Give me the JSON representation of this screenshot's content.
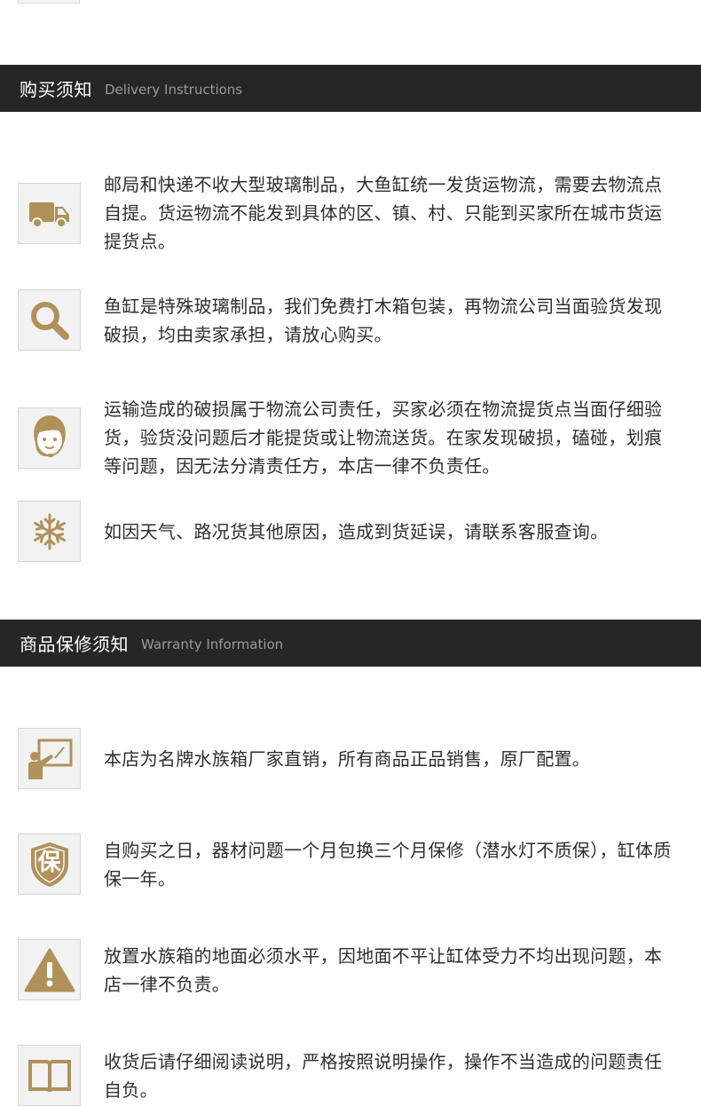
{
  "colors": {
    "header_bg": "#262626",
    "icon_gold": "#B0915A",
    "text": "#2e2e2e"
  },
  "delivery": {
    "title_zh": "购买须知",
    "title_en": "Delivery Instructions",
    "items": [
      {
        "icon": "truck-icon",
        "text": "邮局和快递不收大型玻璃制品，大鱼缸统一发货运物流，需要去物流点自提。货运物流不能发到具体的区、镇、村、只能到买家所在城市货运提货点。"
      },
      {
        "icon": "magnifier-icon",
        "text": "鱼缸是特殊玻璃制品，我们免费打木箱包装，再物流公司当面验货发现破损，均由卖家承担，请放心购买。"
      },
      {
        "icon": "customer-service-icon",
        "text": "运输造成的破损属于物流公司责任，买家必须在物流提货点当面仔细验货，验货没问题后才能提货或让物流送货。在家发现破损，磕碰，划痕等问题，因无法分清责任方，本店一律不负责任。"
      },
      {
        "icon": "snowflake-icon",
        "text": "如因天气、路况货其他原因，造成到货延误，请联系客服查询。"
      }
    ]
  },
  "warranty": {
    "title_zh": "商品保修须知",
    "title_en": "Warranty Information",
    "items": [
      {
        "icon": "teacher-board-icon",
        "text": "本店为名牌水族箱厂家直销，所有商品正品销售，原厂配置。"
      },
      {
        "icon": "shield-bao-icon",
        "badge": "保",
        "text": "自购买之日，器材问题一个月包换三个月保修（潜水灯不质保），缸体质保一年。"
      },
      {
        "icon": "warning-icon",
        "text": "放置水族箱的地面必须水平，因地面不平让缸体受力不均出现问题，本店一律不负责。"
      },
      {
        "icon": "book-icon",
        "text": "收货后请仔细阅读说明，严格按照说明操作，操作不当造成的问题责任自负。"
      }
    ]
  }
}
